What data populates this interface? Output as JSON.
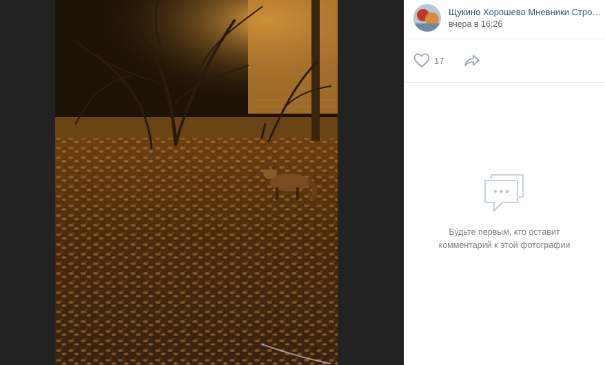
{
  "post": {
    "owner_name": "Щукино Хорошево Мневники Стро…",
    "time": "вчера в 16:26"
  },
  "actions": {
    "like_count": "17",
    "like_icon": "heart-icon",
    "share_icon": "share-arrow-icon"
  },
  "comments": {
    "empty_text": "Будьте первым, кто оставит комментарий к этой фотографии",
    "empty_icon": "comment-bubble-icon"
  },
  "colors": {
    "link": "#2a5885",
    "muted": "#828282",
    "viewer_bg": "#222222"
  }
}
